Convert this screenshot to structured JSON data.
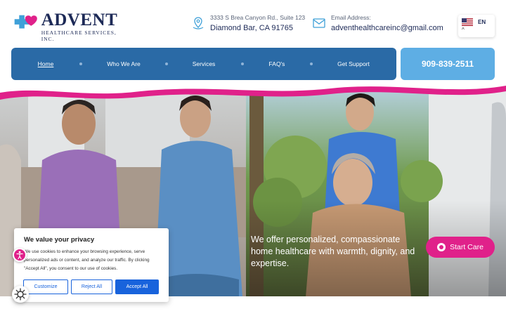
{
  "header": {
    "logo": {
      "title": "ADVENT",
      "subtitle": "HEALTHCARE SERVICES, INC."
    },
    "address": {
      "line1": "3333 S Brea Canyon Rd., Suite 123",
      "line2": "Diamond Bar, CA 91765",
      "icon": "map-pin-icon"
    },
    "email": {
      "label": "Email Address:",
      "value": "adventhealthcareinc@gmail.com",
      "icon": "mail-icon"
    },
    "language": {
      "code": "EN",
      "flag": "us-flag-icon",
      "caret": "^"
    }
  },
  "nav": {
    "items": [
      {
        "label": "Home",
        "active": true
      },
      {
        "label": "Who We Are"
      },
      {
        "label": "Services"
      },
      {
        "label": "FAQ's"
      },
      {
        "label": "Get Support"
      }
    ],
    "phone": "909-839-2511"
  },
  "hero": {
    "tagline": "We offer personalized, compassionate home healthcare with warmth, dignity, and expertise.",
    "cta": "Start Care"
  },
  "cookie_banner": {
    "title": "We value your privacy",
    "body": "We use cookies to enhance your browsing experience, serve personalized ads or content, and analyze our traffic. By clicking \"Accept All\", you consent to our use of cookies.",
    "buttons": {
      "customize": "Customize",
      "reject": "Reject All",
      "accept": "Accept All"
    }
  },
  "colors": {
    "brand_blue": "#2a6aa6",
    "light_blue": "#5eaee4",
    "pink": "#e0218a",
    "navy": "#1d2a57",
    "cookie_blue": "#1863dc"
  }
}
